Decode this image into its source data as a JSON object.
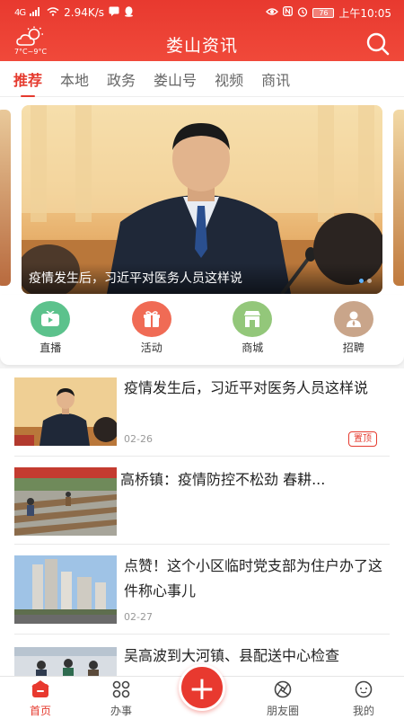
{
  "status_bar": {
    "signal": "4G",
    "speed": "2.94K/s",
    "battery": "76",
    "time": "上午10:05"
  },
  "header": {
    "title": "娄山资讯",
    "weather_temp": "7°C~9°C",
    "weather_icon": "cloud-sun-icon",
    "search_icon": "search-icon"
  },
  "tabs": [
    {
      "label": "推荐",
      "active": true
    },
    {
      "label": "本地"
    },
    {
      "label": "政务"
    },
    {
      "label": "娄山号"
    },
    {
      "label": "视频"
    },
    {
      "label": "商讯"
    }
  ],
  "banner": {
    "caption": "疫情发生后，习近平对医务人员这样说"
  },
  "quick_links": [
    {
      "label": "直播",
      "icon": "tv-icon",
      "color": "#5cc28c"
    },
    {
      "label": "活动",
      "icon": "gift-icon",
      "color": "#f06b55"
    },
    {
      "label": "商城",
      "icon": "shop-icon",
      "color": "#93c77a"
    },
    {
      "label": "招聘",
      "icon": "person-icon",
      "color": "#c9a58a"
    }
  ],
  "news": [
    {
      "title": "疫情发生后，习近平对医务人员这样说",
      "date": "02-26",
      "badge": "置顶"
    },
    {
      "title": "高桥镇：疫情防控不松劲 春耕...",
      "date": ""
    },
    {
      "title": "点赞！这个小区临时党支部为住户办了这件称心事儿",
      "date": "02-27"
    },
    {
      "title": "吴高波到大河镇、县配送中心检查",
      "date": ""
    }
  ],
  "bottom_nav": [
    {
      "label": "首页",
      "icon": "home-icon",
      "active": true
    },
    {
      "label": "办事",
      "icon": "grid-icon"
    },
    {
      "label": "+",
      "icon": "plus-icon"
    },
    {
      "label": "朋友圈",
      "icon": "aperture-icon"
    },
    {
      "label": "我的",
      "icon": "user-icon"
    }
  ],
  "colors": {
    "brand_red": "#e8392f",
    "accent_blue": "#5fb4ff"
  }
}
